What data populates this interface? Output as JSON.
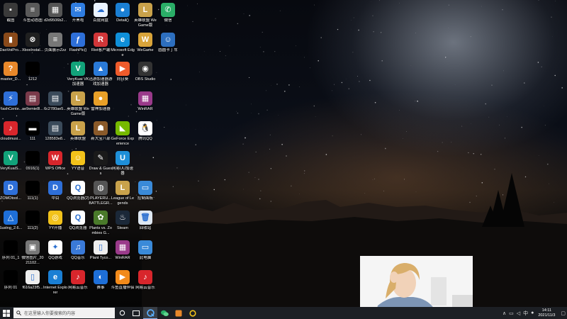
{
  "desktop": {
    "icons": [
      {
        "label": "截图",
        "color": "#3a3a3a",
        "glyph": "▪"
      },
      {
        "label": "斗鱼动态图",
        "color": "#5a5a5a",
        "glyph": "≡"
      },
      {
        "label": "d2d9506b2...",
        "color": "#555555",
        "glyph": "▦"
      },
      {
        "label": "开黑啦",
        "color": "#2f7de1",
        "glyph": "✉"
      },
      {
        "label": "百度网盘",
        "color": "#eaf3ff",
        "glyph": "☁"
      },
      {
        "label": "Detail()",
        "color": "#1a7fd4",
        "glyph": "●"
      },
      {
        "label": "英雄联盟 WeGame版",
        "color": "#c9a24b",
        "glyph": "L"
      },
      {
        "label": "微信",
        "color": "#2aae67",
        "glyph": "✆"
      },
      {
        "label": "DaoVoiPro...",
        "color": "#8a4a1a",
        "glyph": "▮"
      },
      {
        "label": "XboxInstal...",
        "color": "#202020",
        "glyph": "⊗"
      },
      {
        "label": "页面展示Zzz",
        "color": "#777777",
        "glyph": "≡"
      },
      {
        "label": "FlashPlc()",
        "color": "#2e6fd8",
        "glyph": "ƒ"
      },
      {
        "label": "Riot客户端",
        "color": "#d13639",
        "glyph": "R"
      },
      {
        "label": "Microsoft Edge",
        "color": "#0f8fd8",
        "glyph": "e"
      },
      {
        "label": "WeGame",
        "color": "#d9a43a",
        "glyph": "W"
      },
      {
        "label": "圆圆卡丁车",
        "color": "#2d6fbf",
        "glyph": "☺"
      },
      {
        "label": "master_D...",
        "color": "#e8882a",
        "glyph": "?"
      },
      {
        "label": "1212",
        "color": "#000000",
        "glyph": ""
      },
      {
        "label": "VeryKuai VK加速器",
        "color": "#12a37a",
        "glyph": "V"
      },
      {
        "label": "迅游加速器游戏加速器",
        "color": "#2a7ad8",
        "glyph": "▲"
      },
      {
        "label": "向日葵",
        "color": "#ef5b2b",
        "glyph": "▶"
      },
      {
        "label": "OBS Studio",
        "color": "#333333",
        "glyph": "◉"
      },
      {
        "label": "FlashCente...",
        "color": "#2e6fd8",
        "glyph": "⚡"
      },
      {
        "label": "ae9emie8l...",
        "color": "#7a3a4a",
        "glyph": "▤"
      },
      {
        "label": "6c2780ae5...",
        "color": "#3a4a5a",
        "glyph": "▤"
      },
      {
        "label": "英雄联盟 WeGame版",
        "color": "#c9a24b",
        "glyph": "L"
      },
      {
        "label": "雷神加速器",
        "color": "#e8a028",
        "glyph": "●"
      },
      {
        "label": "WinRAR",
        "color": "#9a3a8a",
        "glyph": "▦"
      },
      {
        "label": "cloudmusi...",
        "color": "#d8262c",
        "glyph": "♪"
      },
      {
        "label": "111",
        "color": "#000000",
        "glyph": "▬"
      },
      {
        "label": "128583e8...",
        "color": "#3a4a5a",
        "glyph": "▤"
      },
      {
        "label": "英雄联盟",
        "color": "#c9a24b",
        "glyph": "L"
      },
      {
        "label": "新大宝八部",
        "color": "#8a5a2a",
        "glyph": "☗"
      },
      {
        "label": "GeForce Experience",
        "color": "#76b900",
        "glyph": "◣"
      },
      {
        "label": "腾讯QQ",
        "color": "#ffffff",
        "glyph": "🐧"
      },
      {
        "label": "VeryKuaiS...",
        "color": "#12a37a",
        "glyph": "V"
      },
      {
        "label": "0916(1)",
        "color": "#000000",
        "glyph": ""
      },
      {
        "label": "WPS Office",
        "color": "#d8262c",
        "glyph": "W"
      },
      {
        "label": "YY语音",
        "color": "#f2c21a",
        "glyph": "☺"
      },
      {
        "label": "Draw & Guess",
        "color": "#1a1a1a",
        "glyph": "✎"
      },
      {
        "label": "网易UU加速器",
        "color": "#1e8fd8",
        "glyph": "U"
      },
      {
        "label": "ZOMOtool...",
        "color": "#2e6fd8",
        "glyph": "D"
      },
      {
        "label": "111(1)",
        "color": "#000000",
        "glyph": ""
      },
      {
        "label": "中目",
        "color": "#2e6fd8",
        "glyph": "D"
      },
      {
        "label": "QQ浏览器(2)",
        "color": "#ffffff",
        "glyph": "Q"
      },
      {
        "label": "PLAYERU... BATTLEGR...",
        "color": "#555555",
        "glyph": "◍"
      },
      {
        "label": "League of Legends",
        "color": "#c9a24b",
        "glyph": "L"
      },
      {
        "label": "控制面板",
        "color": "#3a8ad8",
        "glyph": "▭"
      },
      {
        "label": "Sustng_2.6...",
        "color": "#1e6fd8",
        "glyph": "△"
      },
      {
        "label": "111(2)",
        "color": "#000000",
        "glyph": ""
      },
      {
        "label": "YY开播",
        "color": "#f2c21a",
        "glyph": "◎"
      },
      {
        "label": "QQ浏览器",
        "color": "#ffffff",
        "glyph": "Q"
      },
      {
        "label": "Plants vs. Zombies G...",
        "color": "#4a7a2a",
        "glyph": "✿"
      },
      {
        "label": "Steam",
        "color": "#1b2838",
        "glyph": "♨"
      },
      {
        "label": "回收站",
        "color": "#dfe8f2",
        "glyph": "🗑"
      },
      {
        "label": "序列 01_1",
        "color": "#000000",
        "glyph": ""
      },
      {
        "label": "微信图片_2021102...",
        "color": "#777777",
        "glyph": "▣"
      },
      {
        "label": "QQ游戏",
        "color": "#ffffff",
        "glyph": "✦"
      },
      {
        "label": "QQ音乐",
        "color": "#3a7ad8",
        "glyph": "♫"
      },
      {
        "label": "Plant Tyco...",
        "color": "#eeeeee",
        "glyph": "▯"
      },
      {
        "label": "WinRAR",
        "color": "#9a3a8a",
        "glyph": "▦"
      },
      {
        "label": "此电脑",
        "color": "#3a8ad8",
        "glyph": "▭"
      },
      {
        "label": "序列 01",
        "color": "#000000",
        "glyph": ""
      },
      {
        "label": "f616a23f5...",
        "color": "#eeeeee",
        "glyph": "▯"
      },
      {
        "label": "Internet Explorer",
        "color": "#1a7fd4",
        "glyph": "e"
      },
      {
        "label": "网易云音乐",
        "color": "#d8262c",
        "glyph": "♪"
      },
      {
        "label": "赛事",
        "color": "#1e6fd8",
        "glyph": "◐"
      },
      {
        "label": "斗鱼直播伴侣",
        "color": "#f28a1a",
        "glyph": "▶"
      },
      {
        "label": "网易云音乐",
        "color": "#d8262c",
        "glyph": "♪"
      }
    ]
  },
  "taskbar": {
    "search_placeholder": "在这里输入你要搜索的内容",
    "clock_time": "14:11",
    "clock_date": "2021/11/3"
  }
}
